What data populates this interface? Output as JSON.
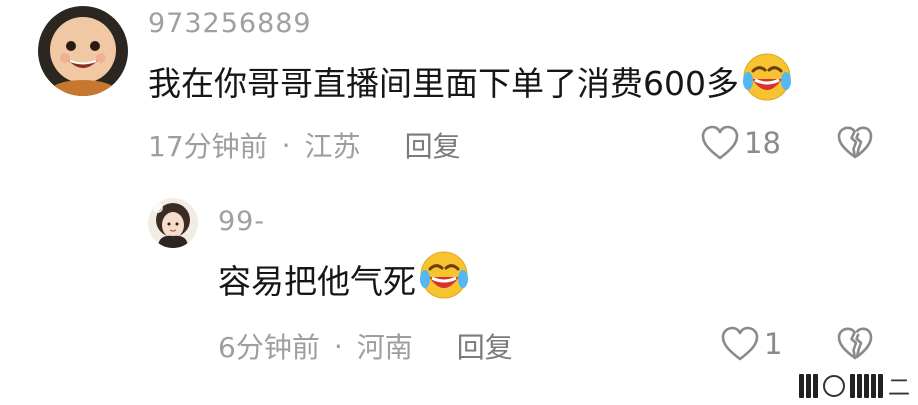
{
  "comments": [
    {
      "username": "973256889",
      "text": "我在你哥哥直播间里面下单了消费600多",
      "emoji": "crying-laughing-emoji",
      "time": "17分钟前",
      "location": "江苏",
      "reply_label": "回复",
      "like_count": "18"
    }
  ],
  "replies": [
    {
      "username": "99-",
      "text": "容易把他气死",
      "emoji": "crying-laughing-emoji",
      "time": "6分钟前",
      "location": "河南",
      "reply_label": "回复",
      "like_count": "1"
    }
  ],
  "separator": "·",
  "watermark_text": "二",
  "colors": {
    "text": "#161616",
    "meta": "#9e9e9e",
    "emoji_face": "#f7c32e",
    "emoji_mouth": "#d8322f"
  }
}
